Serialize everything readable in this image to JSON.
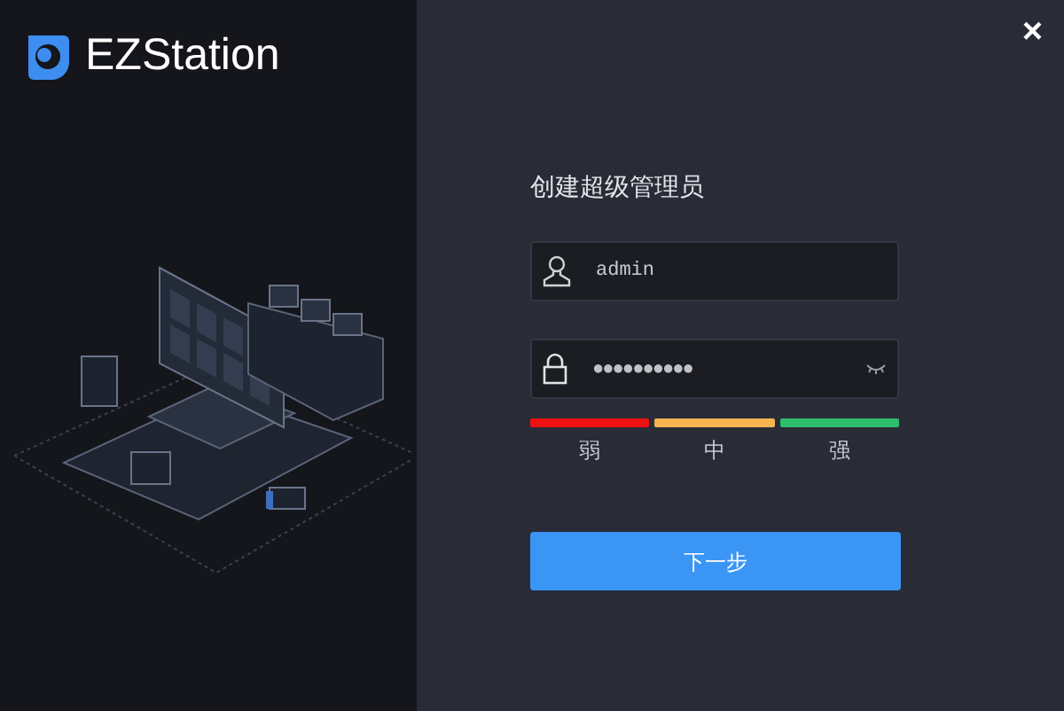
{
  "brand": {
    "name": "EZStation"
  },
  "close_button": {
    "label": "×"
  },
  "form": {
    "title": "创建超级管理员",
    "username": {
      "value": "admin"
    },
    "password": {
      "value": "●●●●●●●●●●"
    },
    "strength_levels": [
      {
        "label": "弱",
        "color": "#ee1111"
      },
      {
        "label": "中",
        "color": "#f5b352"
      },
      {
        "label": "强",
        "color": "#2dbf6e"
      }
    ],
    "next_button": {
      "label": "下一步"
    }
  }
}
